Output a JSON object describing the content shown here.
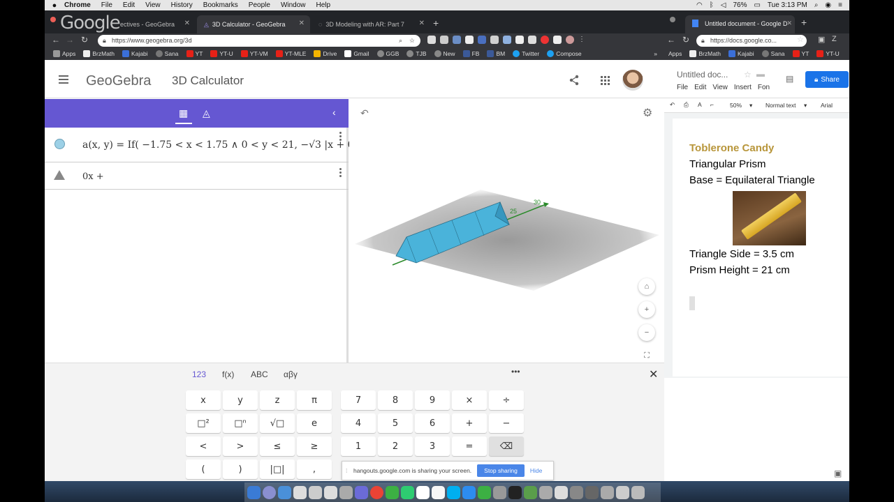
{
  "menubar": {
    "items": [
      "Chrome",
      "File",
      "Edit",
      "View",
      "History",
      "Bookmarks",
      "People",
      "Window",
      "Help"
    ],
    "battery": "76%",
    "clock": "Tue 3:13 PM"
  },
  "watermark": "Google",
  "browser_left": {
    "tabs": [
      {
        "label": "ectives - GeoGebra"
      },
      {
        "label": "3D Calculator - GeoGebra"
      },
      {
        "label": "3D Modeling with AR: Part 7"
      }
    ],
    "new_tab": "+",
    "url": "https://www.geogebra.org/3d",
    "bookmarks": [
      "Apps",
      "BrzMath",
      "Kajabi",
      "Sana",
      "YT",
      "YT-U",
      "YT-VM",
      "YT-MLE",
      "Drive",
      "Gmail",
      "GGB",
      "TJB",
      "New",
      "FB",
      "BM",
      "Twitter",
      "Compose"
    ],
    "bookmarks_more": "»"
  },
  "geogebra": {
    "logo": "GeoGebra",
    "app_title": "3D Calculator",
    "algebra": {
      "tab_calc_icon": "calculator-icon",
      "tab_tools_icon": "tools-icon",
      "collapse": "‹",
      "entry1": "a(x, y)  =  If( −1.75 < x < 1.75 ∧ 0 < y < 21, −√3 |x + 0",
      "entry2": "0x +"
    },
    "graphics": {
      "undo": "↶",
      "settings": "⚙",
      "axis_label_25": "25",
      "axis_label_30": "30",
      "home": "⌂",
      "zoom_in": "+",
      "zoom_out": "−",
      "fullscreen": "⛶"
    },
    "keyboard": {
      "tabs": [
        "123",
        "f(x)",
        "ABC",
        "αβγ"
      ],
      "more": "•••",
      "close": "✕",
      "row1": [
        "x",
        "y",
        "z",
        "π",
        "7",
        "8",
        "9",
        "×",
        "÷"
      ],
      "row2": [
        "□²",
        "□ⁿ",
        "√□",
        "e",
        "4",
        "5",
        "6",
        "+",
        "−"
      ],
      "row3": [
        "<",
        ">",
        "≤",
        "≥",
        "1",
        "2",
        "3",
        "=",
        "⌫"
      ],
      "row4": [
        "(",
        ")",
        "|□|",
        ","
      ]
    },
    "screenshare": {
      "message": "hangouts.google.com is sharing your screen.",
      "stop": "Stop sharing",
      "hide": "Hide"
    }
  },
  "browser_right": {
    "tab": "Untitled document - Google D",
    "url": "https://docs.google.co...",
    "bookmarks": [
      "Apps",
      "BrzMath",
      "Kajabi",
      "Sana",
      "YT",
      "YT-U"
    ]
  },
  "docs": {
    "title": "Untitled doc...",
    "menu": [
      "File",
      "Edit",
      "View",
      "Insert",
      "Fon"
    ],
    "share": "Share",
    "zoom": "50%",
    "style": "Normal text",
    "font": "Arial",
    "lines": [
      "Toblerone Candy",
      "Triangular Prism",
      "Base = Equilateral Triangle",
      "Triangle Side = 3.5 cm",
      "Prism Height = 21 cm"
    ]
  },
  "colors": {
    "geogebra_purple": "#6557d2",
    "prism_blue": "#4ab3da",
    "docs_blue": "#1a73e8",
    "title_gold": "#b8963b"
  }
}
